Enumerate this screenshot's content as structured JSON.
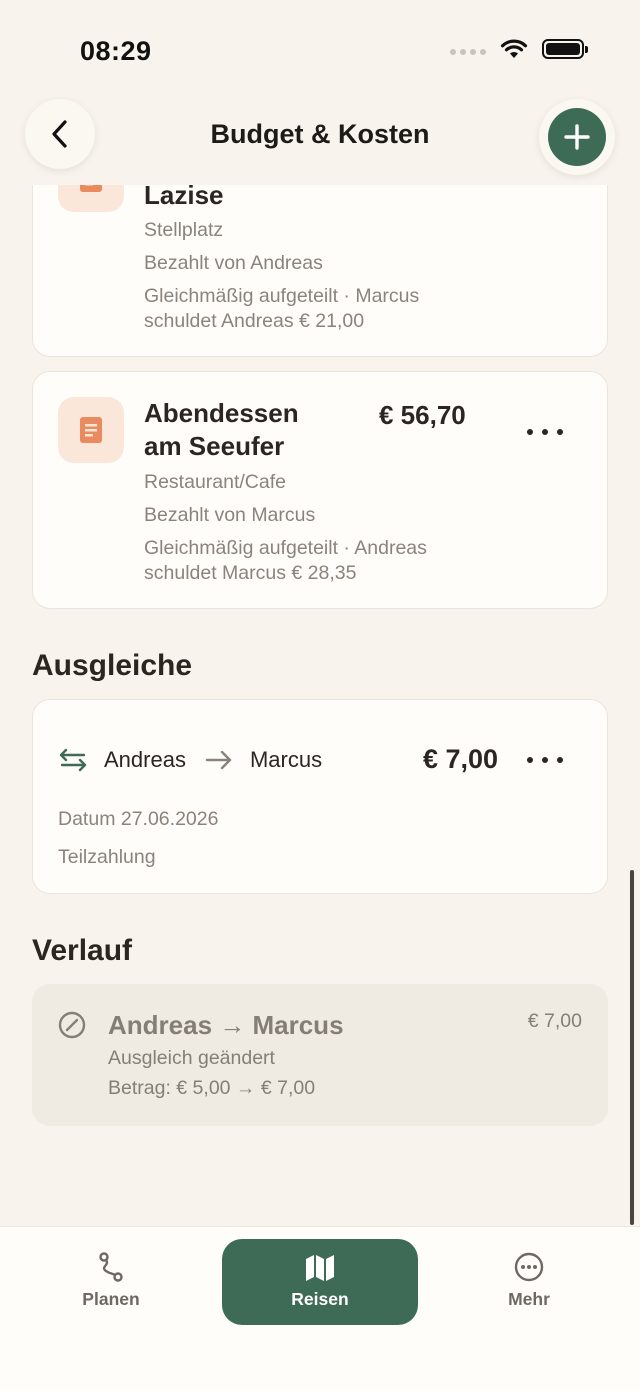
{
  "status": {
    "time": "08:29"
  },
  "header": {
    "title": "Budget & Kosten",
    "back_icon": "chevron-left-icon",
    "add_icon": "plus-icon",
    "accent": "#3e6b56"
  },
  "expenses": [
    {
      "title": "Lazise",
      "category": "Stellplatz",
      "paid_by": "Bezahlt von Andreas",
      "split_line1": "Gleichmäßig aufgeteilt · Marcus",
      "split_line2": "schuldet Andreas € 21,00",
      "icon": "receipt-icon"
    },
    {
      "title_line1": "Abendessen",
      "title_line2": "am Seeufer",
      "amount": "€ 56,70",
      "category": "Restaurant/Cafe",
      "paid_by": "Bezahlt von Marcus",
      "split_line1": "Gleichmäßig aufgeteilt · Andreas",
      "split_line2": "schuldet Marcus € 28,35",
      "icon": "receipt-icon"
    }
  ],
  "settlements": {
    "title": "Ausgleiche",
    "item": {
      "from": "Andreas",
      "to": "Marcus",
      "amount": "€ 7,00",
      "date": "Datum 27.06.2026",
      "type": "Teilzahlung"
    }
  },
  "history": {
    "title": "Verlauf",
    "item": {
      "title": "Andreas → Marcus",
      "amount": "€ 7,00",
      "action": "Ausgleich geändert",
      "detail": "Betrag: € 5,00 → € 7,00"
    }
  },
  "tabs": [
    {
      "label": "Planen",
      "icon": "route-icon"
    },
    {
      "label": "Reisen",
      "icon": "map-icon",
      "active": true
    },
    {
      "label": "Mehr",
      "icon": "more-circle-icon"
    }
  ]
}
